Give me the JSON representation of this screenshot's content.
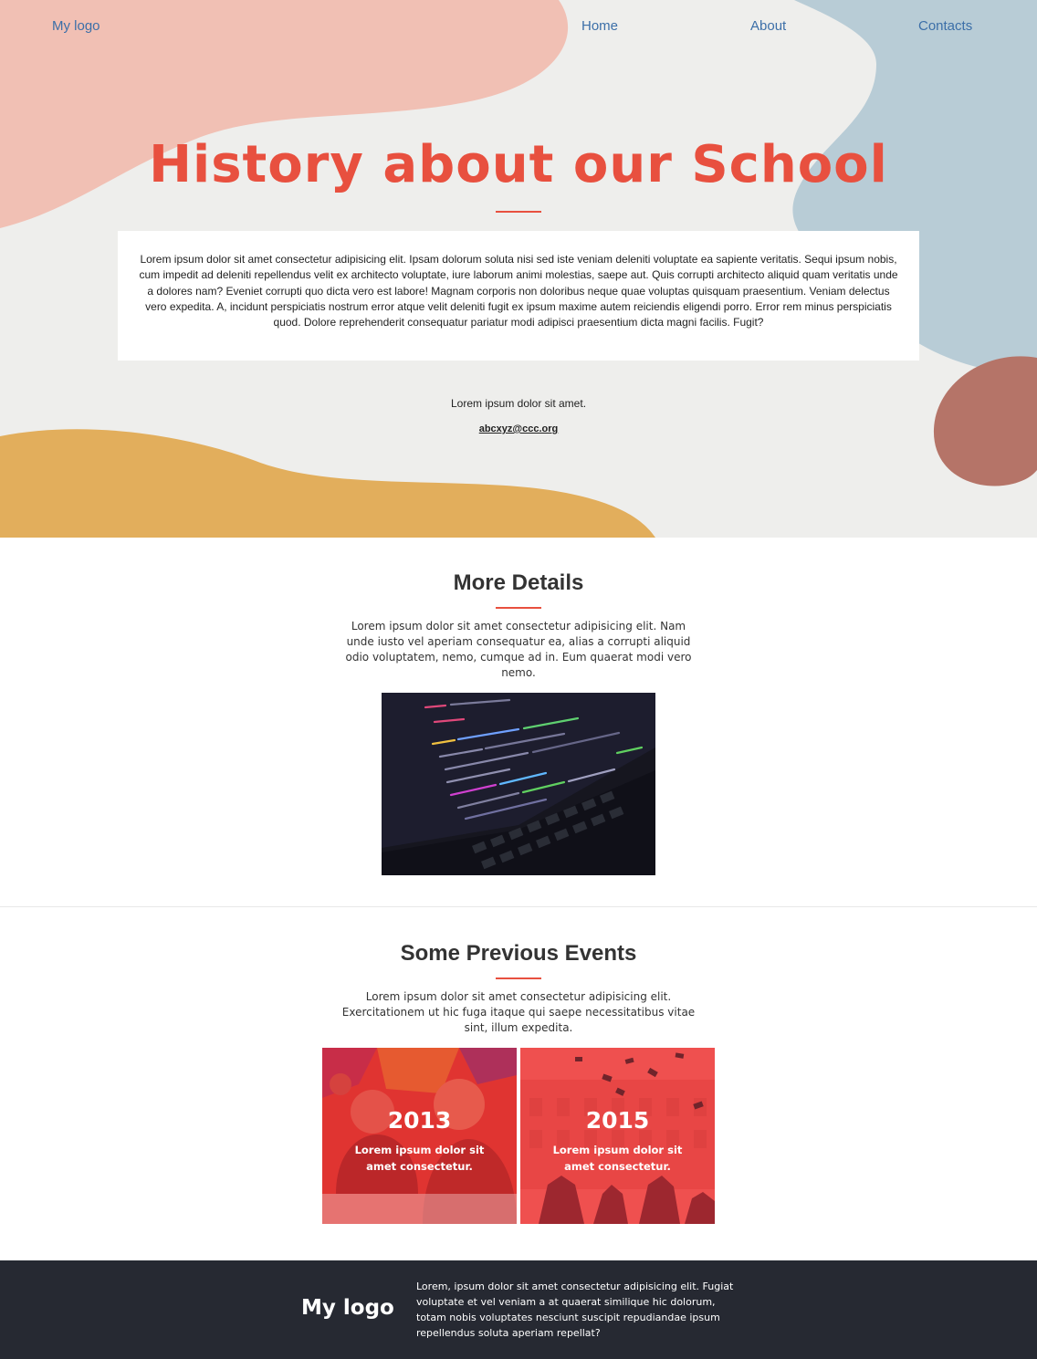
{
  "nav": {
    "logo": "My logo",
    "links": [
      "Home",
      "About",
      "Contacts"
    ]
  },
  "hero": {
    "title": "History about our School",
    "paragraph": "Lorem ipsum dolor sit amet consectetur adipisicing elit. Ipsam dolorum soluta nisi sed iste veniam deleniti voluptate ea sapiente veritatis. Sequi ipsum nobis, cum impedit ad deleniti repellendus velit ex architecto voluptate, iure laborum animi molestias, saepe aut. Quis corrupti architecto aliquid quam veritatis unde a dolores nam? Eveniet corrupti quo dicta vero est labore! Magnam corporis non doloribus neque quae voluptas quisquam praesentium. Veniam delectus vero expedita. A, incidunt perspiciatis nostrum error atque velit deleniti fugit ex ipsum maxime autem reiciendis eligendi porro. Error rem minus perspiciatis quod. Dolore reprehenderit consequatur pariatur modi adipisci praesentium dicta magni facilis. Fugit?",
    "small_text": "Lorem ipsum dolor sit amet.",
    "email": "abcxyz@ccc.org"
  },
  "details": {
    "title": "More Details",
    "text": "Lorem ipsum dolor sit amet consectetur adipisicing elit. Nam unde iusto vel aperiam consequatur ea, alias a corrupti aliquid odio voluptatem, nemo, cumque ad in. Eum quaerat modi vero nemo."
  },
  "events": {
    "title": "Some Previous Events",
    "text": "Lorem ipsum dolor sit amet consectetur adipisicing elit. Exercitationem ut hic fuga itaque qui saepe necessitatibus vitae sint, illum expedita.",
    "cards": [
      {
        "year": "2013",
        "desc": "Lorem ipsum dolor sit amet consectetur."
      },
      {
        "year": "2015",
        "desc": "Lorem ipsum dolor sit amet consectetur."
      }
    ]
  },
  "footer": {
    "logo": "My logo",
    "text": "Lorem, ipsum dolor sit amet consectetur adipisicing elit. Fugiat voluptate et vel veniam a at quaerat similique hic dolorum, totam nobis voluptates nesciunt suscipit repudiandae ipsum repellendus soluta aperiam repellat?"
  },
  "colors": {
    "accent": "#e8503f",
    "nav_link": "#3c6fa8",
    "footer_bg": "#262932",
    "card_overlay": "#f03c3c"
  }
}
